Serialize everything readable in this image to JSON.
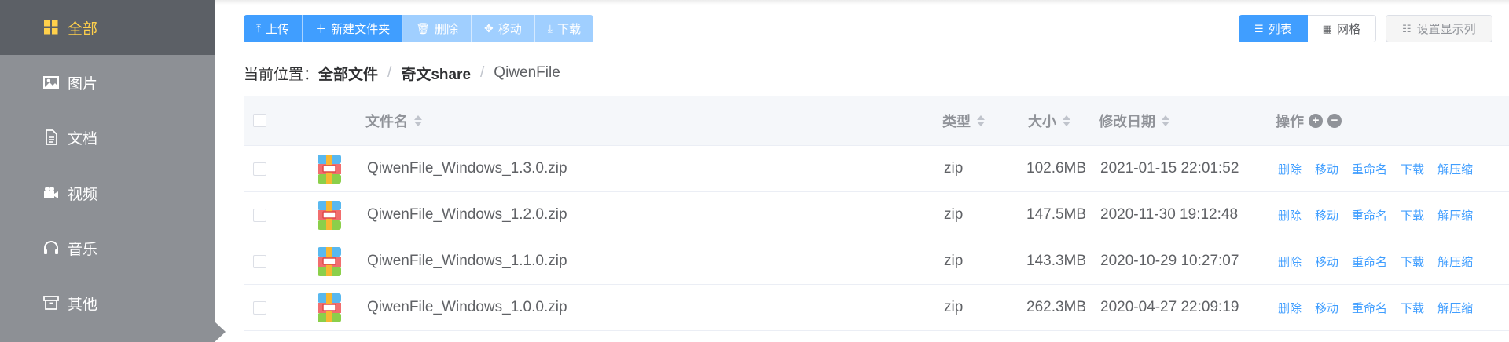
{
  "sidebar": {
    "items": [
      {
        "label": "全部",
        "icon": "grid-icon",
        "active": true
      },
      {
        "label": "图片",
        "icon": "image-icon",
        "active": false
      },
      {
        "label": "文档",
        "icon": "document-icon",
        "active": false
      },
      {
        "label": "视频",
        "icon": "video-icon",
        "active": false
      },
      {
        "label": "音乐",
        "icon": "headphones-icon",
        "active": false
      },
      {
        "label": "其他",
        "icon": "archive-icon",
        "active": false
      }
    ]
  },
  "toolbar": {
    "upload": "上传",
    "new_folder": "新建文件夹",
    "delete": "删除",
    "move": "移动",
    "download": "下载"
  },
  "view": {
    "list": "列表",
    "grid": "网格",
    "set_columns": "设置显示列"
  },
  "breadcrumb": {
    "prefix": "当前位置：",
    "items": [
      "全部文件",
      "奇文share",
      "QiwenFile"
    ],
    "separator": "/"
  },
  "table": {
    "headers": {
      "name": "文件名",
      "type": "类型",
      "size": "大小",
      "date": "修改日期",
      "actions": "操作"
    },
    "actions": [
      "删除",
      "移动",
      "重命名",
      "下载",
      "解压缩"
    ],
    "rows": [
      {
        "name": "QiwenFile_Windows_1.3.0.zip",
        "type": "zip",
        "size": "102.6MB",
        "date": "2021-01-15 22:01:52"
      },
      {
        "name": "QiwenFile_Windows_1.2.0.zip",
        "type": "zip",
        "size": "147.5MB",
        "date": "2020-11-30 19:12:48"
      },
      {
        "name": "QiwenFile_Windows_1.1.0.zip",
        "type": "zip",
        "size": "143.3MB",
        "date": "2020-10-29 10:27:07"
      },
      {
        "name": "QiwenFile_Windows_1.0.0.zip",
        "type": "zip",
        "size": "262.3MB",
        "date": "2020-04-27 22:09:19"
      }
    ]
  },
  "colors": {
    "primary": "#409eff",
    "primary_disabled": "#a0cfff",
    "sidebar_bg": "#8d9095",
    "sidebar_active_bg": "#5c6066",
    "sidebar_active_text": "#ffd04b"
  }
}
